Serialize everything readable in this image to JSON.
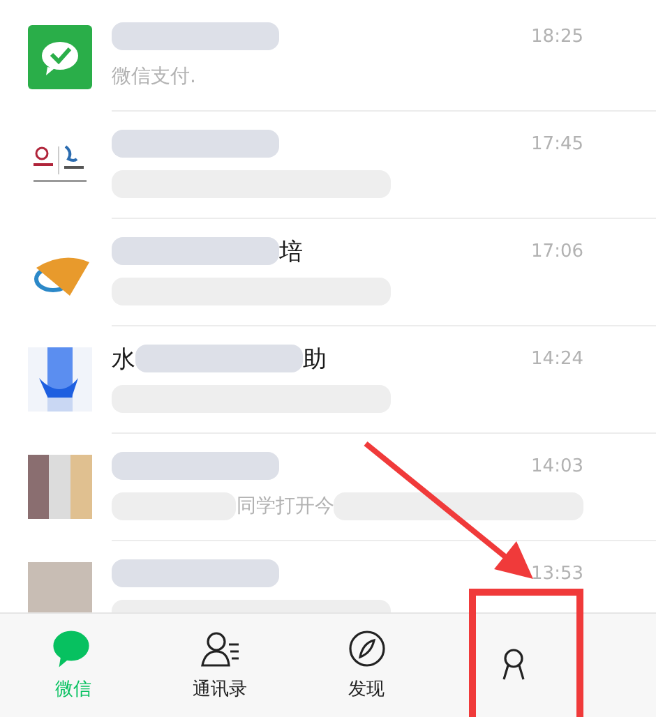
{
  "chats": [
    {
      "kind": "wechat-pay",
      "name": [
        {
          "kind": "blur"
        }
      ],
      "preview": [
        {
          "kind": "text",
          "text": "微信支付."
        }
      ],
      "time": "18:25"
    },
    {
      "kind": "bank-logo",
      "name": [
        {
          "kind": "blur"
        }
      ],
      "preview": [
        {
          "kind": "blur"
        }
      ],
      "time": "17:45"
    },
    {
      "kind": "swoosh-logo",
      "name": [
        {
          "kind": "blur"
        },
        {
          "kind": "text",
          "text": "培"
        }
      ],
      "preview": [
        {
          "kind": "blur"
        }
      ],
      "time": "17:06"
    },
    {
      "kind": "tail-logo",
      "name": [
        {
          "kind": "text",
          "text": "水"
        },
        {
          "kind": "blur"
        },
        {
          "kind": "text",
          "text": "助"
        }
      ],
      "preview": [
        {
          "kind": "blur"
        }
      ],
      "time": "14:24"
    },
    {
      "kind": "group-photo",
      "name": [
        {
          "kind": "blur"
        }
      ],
      "preview": [
        {
          "kind": "blur"
        },
        {
          "kind": "text",
          "text": "同学打开今"
        },
        {
          "kind": "blur"
        }
      ],
      "time": "14:03"
    },
    {
      "kind": "photo",
      "name": [
        {
          "kind": "blur"
        }
      ],
      "preview": [
        {
          "kind": "blur"
        }
      ],
      "time": "13:53"
    }
  ],
  "tabs": [
    {
      "kind": "chat",
      "label": "微信",
      "selected": true,
      "highlighted": false
    },
    {
      "kind": "contacts",
      "label": "通讯录",
      "selected": false,
      "highlighted": false
    },
    {
      "kind": "compass",
      "label": "发现",
      "selected": false,
      "highlighted": false
    },
    {
      "kind": "person",
      "selected": false,
      "highlighted": true
    }
  ]
}
